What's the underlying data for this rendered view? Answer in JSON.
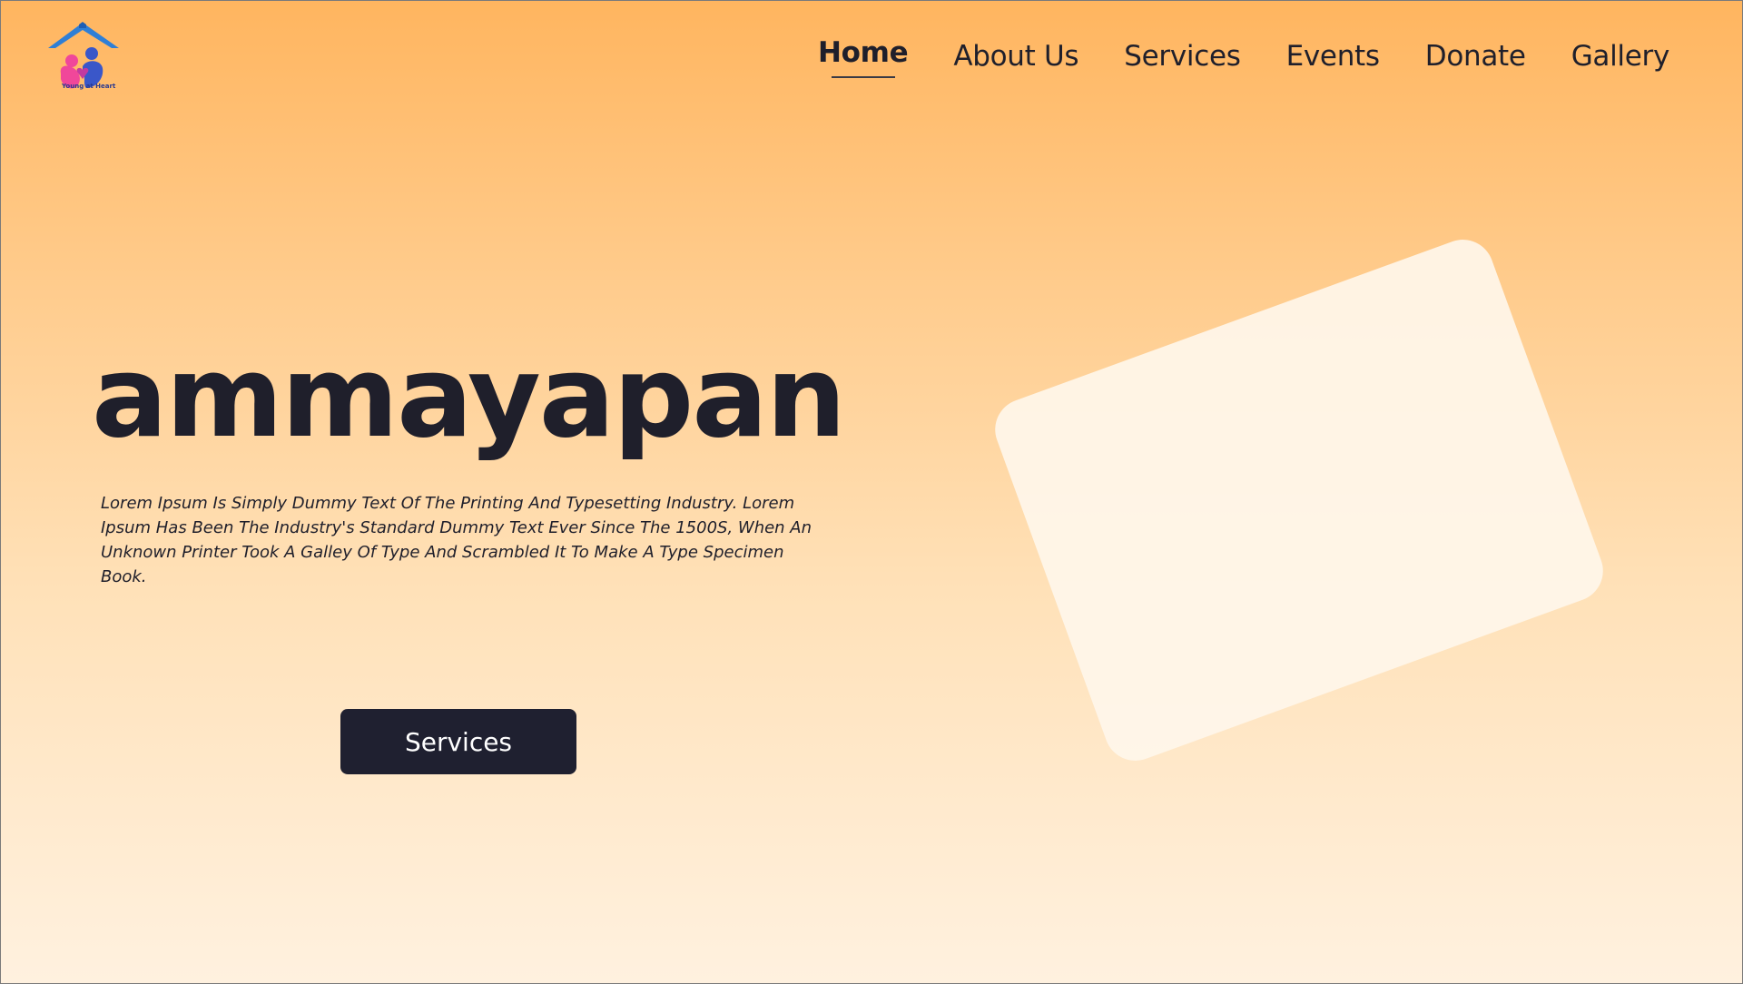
{
  "brand": {
    "logo_icon": "house-family-heart-logo",
    "logo_caption": "Young at Heart",
    "colors": {
      "roof": "#2f7fd6",
      "heart_pink": "#f0479a",
      "figure_blue": "#3a57c9"
    }
  },
  "nav": {
    "items": [
      {
        "label": "Home",
        "active": true
      },
      {
        "label": "About Us",
        "active": false
      },
      {
        "label": "Services",
        "active": false
      },
      {
        "label": "Events",
        "active": false
      },
      {
        "label": "Donate",
        "active": false
      },
      {
        "label": "Gallery",
        "active": false
      }
    ]
  },
  "hero": {
    "title": "ammayapan",
    "description": "Lorem Ipsum Is Simply Dummy Text Of The Printing And Typesetting Industry. Lorem Ipsum Has Been The Industry's Standard Dummy Text Ever Since The 1500S, When An Unknown Printer Took A Galley Of Type And Scrambled It To Make A Type Specimen Book.",
    "button_label": "Services"
  },
  "theme": {
    "gradient_top": "#ffb55f",
    "gradient_bottom": "#fff1df",
    "text_dark": "#1f1f2b",
    "button_bg": "#1f2030",
    "card_color": "#fff6ea"
  }
}
